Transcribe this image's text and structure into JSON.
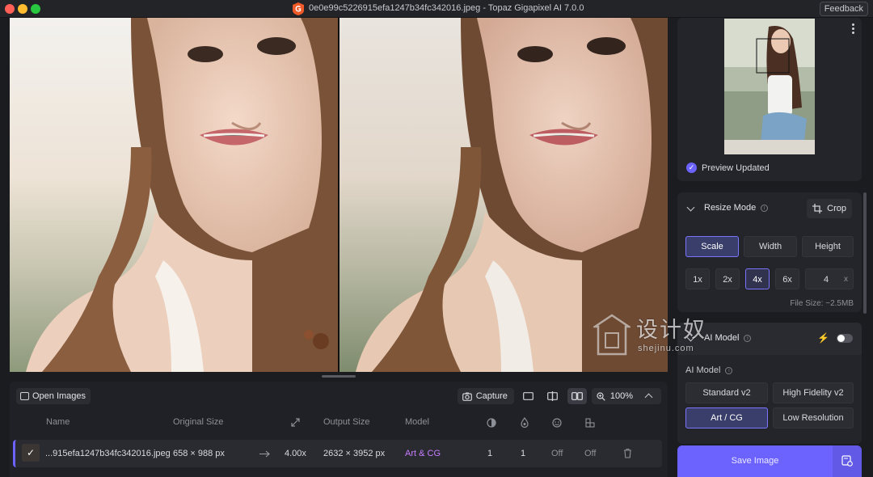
{
  "window": {
    "title": "0e0e99c5226915efa1247b34fc342016.jpeg - Topaz Gigapixel AI 7.0.0",
    "feedback_label": "Feedback",
    "logo_icon": "gigapixel-logo-icon"
  },
  "viewer": {
    "left_pane": "original-preview",
    "right_pane": "enhanced-preview"
  },
  "toolbar": {
    "open_images_label": "Open Images",
    "capture_label": "Capture",
    "view_modes": [
      "single-view-icon",
      "split-view-icon",
      "side-by-side-view-icon"
    ],
    "active_view_mode": "side-by-side",
    "zoom_label": "100%"
  },
  "queue": {
    "headers": {
      "name": "Name",
      "original_size": "Original Size",
      "output_size": "Output Size",
      "model": "Model"
    },
    "header_icons": [
      "resize-arrows-icon",
      "denoise-icon",
      "sharpen-drop-icon",
      "face-recovery-icon",
      "compression-icon"
    ],
    "rows": [
      {
        "name": "...915efa1247b34fc342016.jpeg",
        "original_size": "658 × 988 px",
        "scale": "4.00x",
        "output_size": "2632 × 3952 px",
        "model": "Art & CG",
        "col1": "1",
        "col2": "1",
        "col3": "Off",
        "col4": "Off"
      }
    ]
  },
  "navigator": {
    "status_label": "Preview Updated"
  },
  "resize": {
    "title": "Resize Mode",
    "crop_label": "Crop",
    "modes": [
      "Scale",
      "Width",
      "Height"
    ],
    "selected_mode": "Scale",
    "multipliers": [
      "1x",
      "2x",
      "4x",
      "6x"
    ],
    "selected_multiplier": "4x",
    "custom_value": "4",
    "custom_suffix": "x",
    "file_size": "File Size: ~2.5MB"
  },
  "ai_model": {
    "section_title": "AI Model",
    "label": "AI Model",
    "models": [
      "Standard v2",
      "High Fidelity v2",
      "Art / CG",
      "Low Resolution"
    ],
    "selected_model": "Art / CG",
    "toggle_on": false
  },
  "save": {
    "label": "Save Image"
  },
  "watermark": {
    "text": "设计奴",
    "sub": "shejinu.com"
  },
  "colors": {
    "accent": "#6c63ff",
    "model_text": "#c77dff"
  }
}
